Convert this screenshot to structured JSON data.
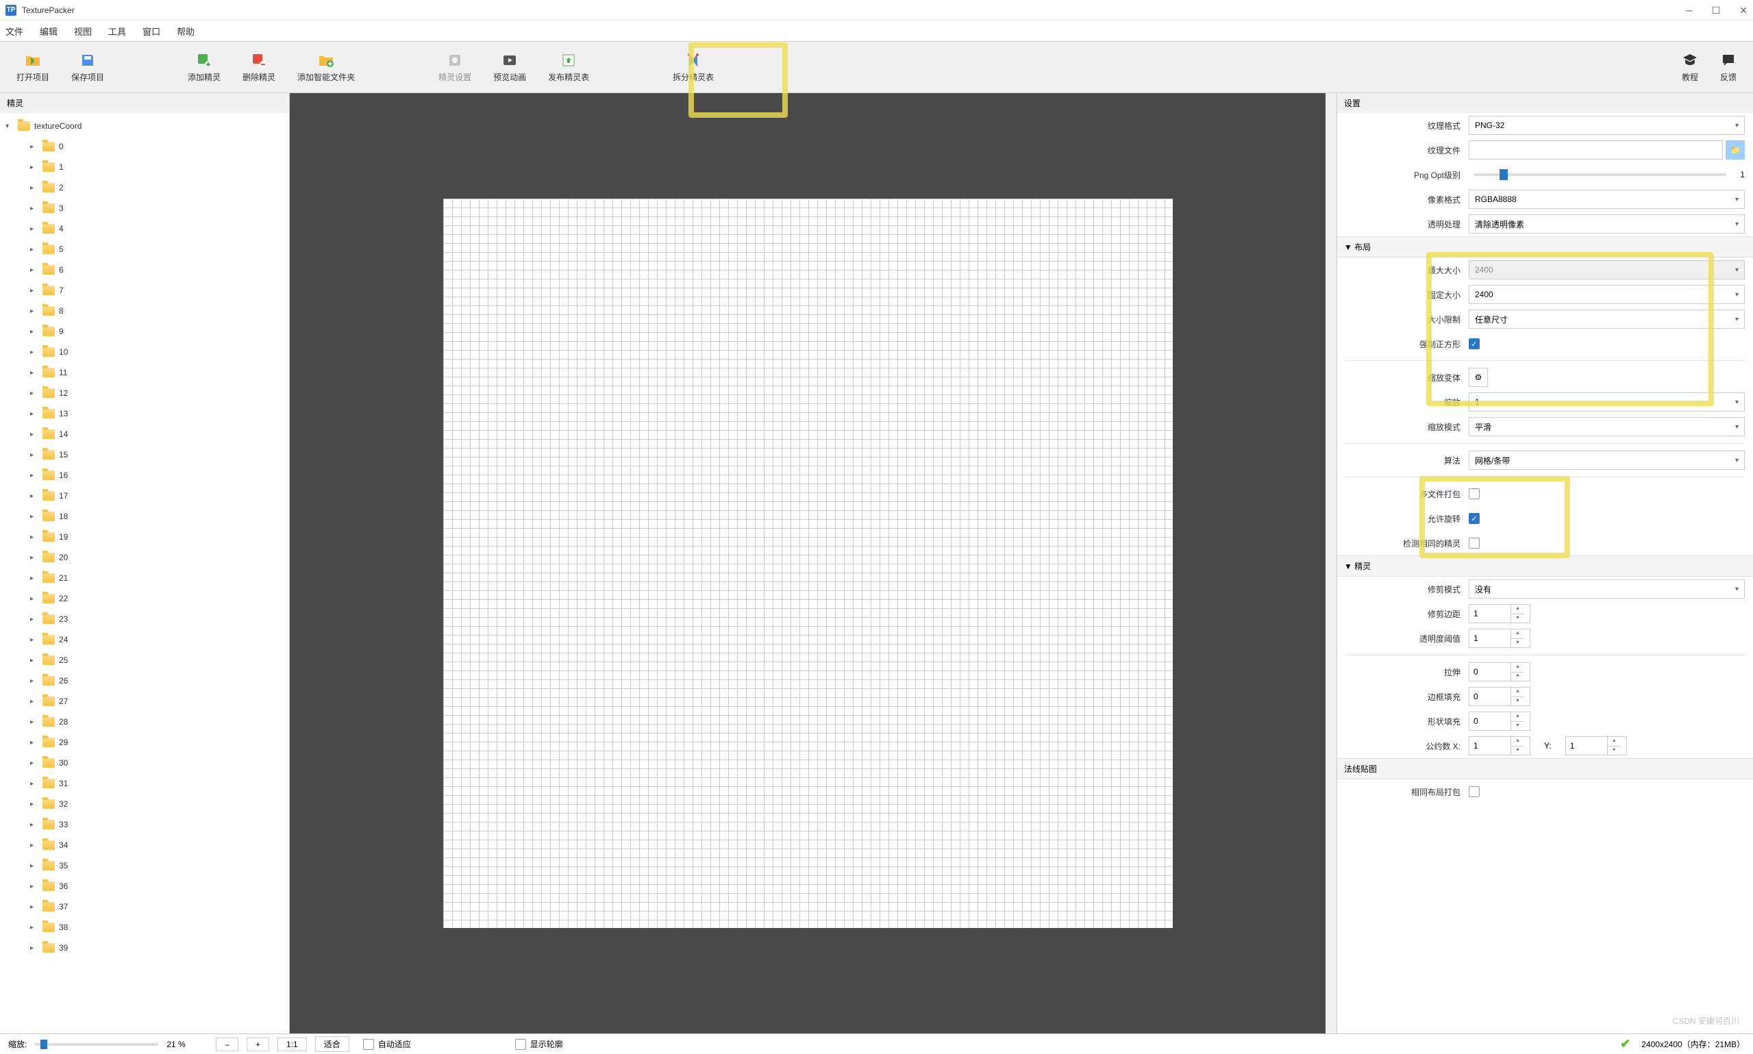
{
  "title": "TexturePacker",
  "menu": [
    "文件",
    "编辑",
    "视图",
    "工具",
    "窗口",
    "帮助"
  ],
  "toolbar": {
    "open": "打开项目",
    "save": "保存项目",
    "add_sprite": "添加精灵",
    "del_sprite": "删除精灵",
    "add_smart": "添加智能文件夹",
    "sprite_settings": "精灵设置",
    "preview_anim": "预览动画",
    "publish": "发布精灵表",
    "split": "拆分精灵表",
    "tutorial": "教程",
    "feedback": "反馈"
  },
  "sidebar": {
    "header": "精灵",
    "root": "textureCoord",
    "items": [
      "0",
      "1",
      "2",
      "3",
      "4",
      "5",
      "6",
      "7",
      "8",
      "9",
      "10",
      "11",
      "12",
      "13",
      "14",
      "15",
      "16",
      "17",
      "18",
      "19",
      "20",
      "21",
      "22",
      "23",
      "24",
      "25",
      "26",
      "27",
      "28",
      "29",
      "30",
      "31",
      "32",
      "33",
      "34",
      "35",
      "36",
      "37",
      "38",
      "39"
    ]
  },
  "props": {
    "header": "设置",
    "tex_format_label": "纹理格式",
    "tex_format": "PNG-32",
    "tex_file_label": "纹理文件",
    "tex_file": "",
    "png_opt_label": "Png Opt级别",
    "png_opt": "1",
    "pixel_fmt_label": "像素格式",
    "pixel_fmt": "RGBA8888",
    "alpha_label": "透明处理",
    "alpha": "清除透明像素",
    "layout_title": "▼ 布局",
    "max_size_label": "最大大小",
    "max_size": "2400",
    "fixed_size_label": "固定大小",
    "fixed_size": "2400",
    "size_limit_label": "大小限制",
    "size_limit": "任意尺寸",
    "force_sq_label": "强制正方形",
    "scale_variant_label": "缩放变体",
    "scale_label": "缩放",
    "scale": "1",
    "scale_mode_label": "缩放模式",
    "scale_mode": "平滑",
    "algo_label": "算法",
    "algo": "网格/条带",
    "multipack_label": "多文件打包",
    "allow_rot_label": "允许旋转",
    "detect_same_label": "检测相同的精灵",
    "sprite_title": "▼ 精灵",
    "trim_mode_label": "修剪模式",
    "trim_mode": "没有",
    "trim_margin_label": "修剪边距",
    "trim_margin": "1",
    "alpha_thr_label": "透明度阈值",
    "alpha_thr": "1",
    "extrude_label": "拉伸",
    "extrude": "0",
    "border_pad_label": "边框填充",
    "border_pad": "0",
    "shape_pad_label": "形状填充",
    "shape_pad": "0",
    "common_div_label": "公约数 X:",
    "cd_x": "1",
    "cd_y_label": "Y:",
    "cd_y": "1",
    "normal_map_title": "法线贴图",
    "same_layout_label": "相同布局打包"
  },
  "status": {
    "zoom_label": "缩放:",
    "zoom_pct": "21 %",
    "oneone": "1:1",
    "fit": "适合",
    "auto_fit": "自动适应",
    "show_outline": "显示轮廓",
    "size_mem": "2400x2400（内存：21MB）",
    "watermark": "CSDN 安康可百川"
  }
}
